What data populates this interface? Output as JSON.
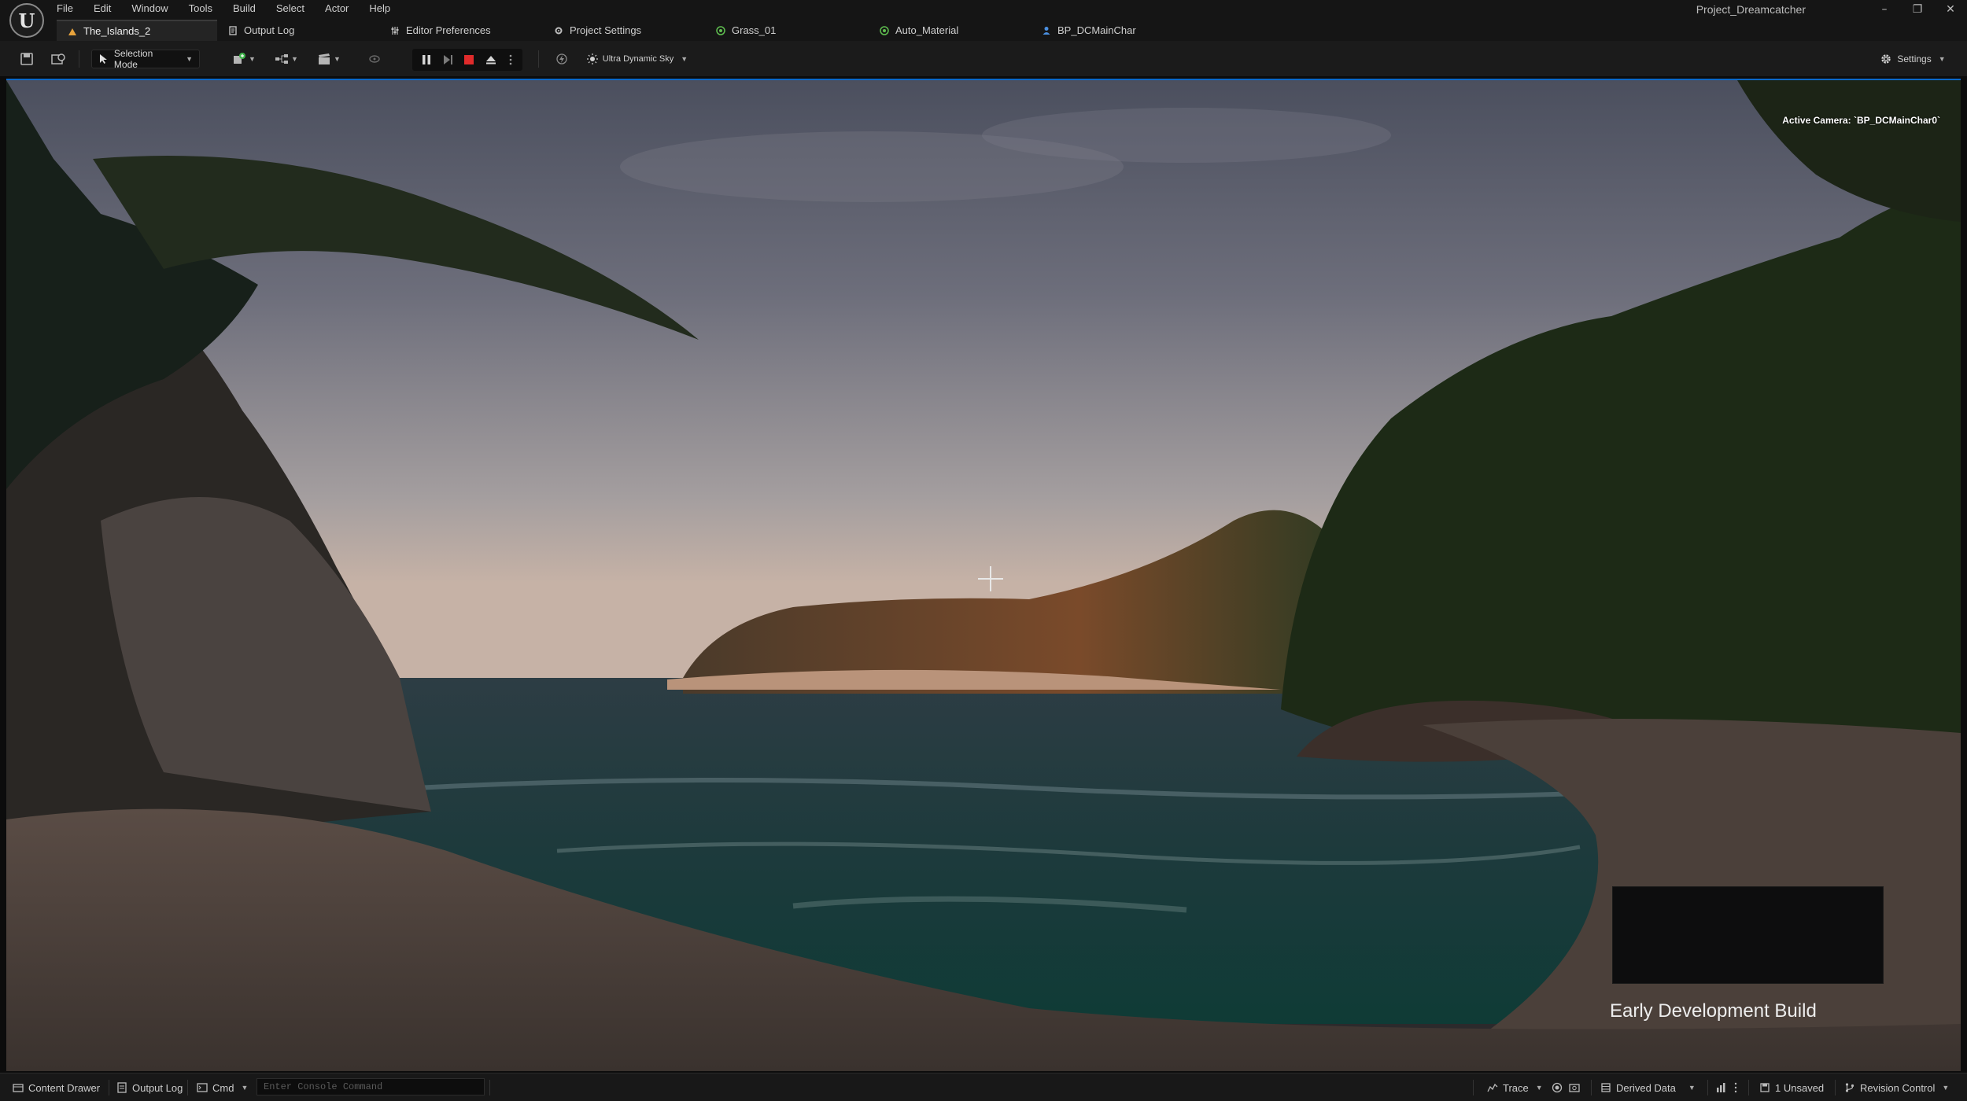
{
  "app": {
    "project_name": "Project_Dreamcatcher",
    "logo_letter": "U"
  },
  "menu": [
    "File",
    "Edit",
    "Window",
    "Tools",
    "Build",
    "Select",
    "Actor",
    "Help"
  ],
  "window_controls": {
    "minimize": "–",
    "restore": "❐",
    "close": "✕"
  },
  "tabs": [
    {
      "label": "The_Islands_2",
      "icon": "level-icon",
      "color": "#e8a33c",
      "active": true
    },
    {
      "label": "Output Log",
      "icon": "log-icon",
      "color": "#bdbdbd",
      "active": false
    },
    {
      "label": "Editor Preferences",
      "icon": "sliders-icon",
      "color": "#bdbdbd",
      "active": false
    },
    {
      "label": "Project Settings",
      "icon": "settings-icon",
      "color": "#bdbdbd",
      "active": false
    },
    {
      "label": "Grass_01",
      "icon": "material-icon",
      "color": "#5fbf4f",
      "active": false
    },
    {
      "label": "Auto_Material",
      "icon": "material-icon",
      "color": "#5fbf4f",
      "active": false
    },
    {
      "label": "BP_DCMainChar",
      "icon": "blueprint-icon",
      "color": "#4a8fe0",
      "active": false
    }
  ],
  "toolbar": {
    "selection_mode": "Selection Mode",
    "sky": "Ultra Dynamic Sky",
    "settings": "Settings",
    "play_stop_color": "#e02b2b"
  },
  "viewport": {
    "active_camera": "Active Camera: `BP_DCMainChar0`",
    "build_label": "Early Development Build",
    "accent": "#0b68c8"
  },
  "statusbar": {
    "content_drawer": "Content Drawer",
    "output_log": "Output Log",
    "cmd": "Cmd",
    "console_placeholder": "Enter Console Command",
    "trace": "Trace",
    "derived_data": "Derived Data",
    "unsaved": "1 Unsaved",
    "revision_control": "Revision Control"
  }
}
